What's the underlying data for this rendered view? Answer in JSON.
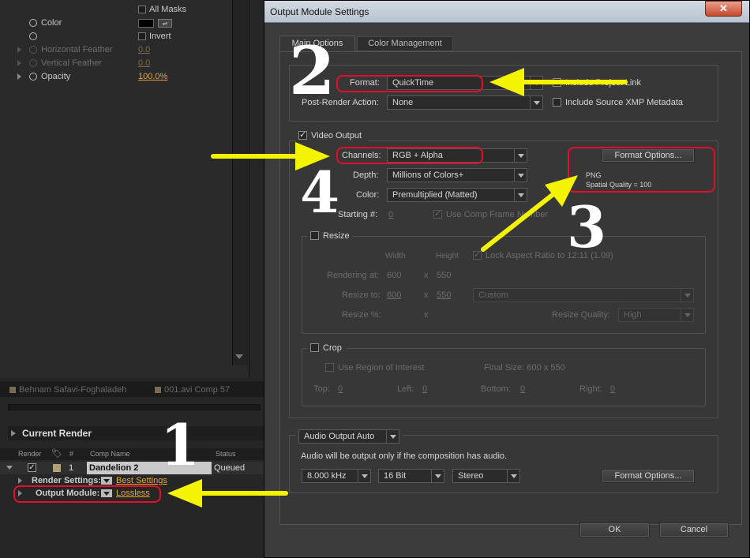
{
  "timeline": {
    "rows": [
      {
        "label": "All Masks",
        "checkbox": true
      },
      {
        "label": "Color",
        "stopwatch": true
      },
      {
        "label": "Invert",
        "checkbox": true,
        "stopwatch": true
      },
      {
        "label": "Horizontal Feather",
        "value": "0.0",
        "disabled": true
      },
      {
        "label": "Vertical Feather",
        "value": "0.0",
        "disabled": true
      },
      {
        "label": "Opacity",
        "value": "100.0%"
      }
    ]
  },
  "bottom_tabs": [
    "Behnam Safavi-Foghaladeh",
    "001.avi Comp 57"
  ],
  "render_queue": {
    "current_render_label": "Current Render",
    "headers": {
      "render": "Render",
      "num": "#",
      "comp_name": "Comp Name",
      "status": "Status"
    },
    "item": {
      "num": "1",
      "comp_name": "Dandelion 2",
      "status": "Queued"
    },
    "render_settings_label": "Render Settings:",
    "render_settings_value": "Best Settings",
    "output_module_label": "Output Module:",
    "output_module_value": "Lossless"
  },
  "dialog": {
    "title": "Output Module Settings",
    "close": "✕",
    "tabs": [
      "Main Options",
      "Color Management"
    ],
    "format_label": "Format:",
    "format_value": "QuickTime",
    "include_project_link": "Include Project Link",
    "post_render_label": "Post-Render Action:",
    "post_render_value": "None",
    "include_xmp": "Include Source XMP Metadata",
    "video_output": "Video Output",
    "channels_label": "Channels:",
    "channels_value": "RGB + Alpha",
    "depth_label": "Depth:",
    "depth_value": "Millions of Colors+",
    "color_label": "Color:",
    "color_value": "Premultiplied (Matted)",
    "starting_label": "Starting #:",
    "starting_value": "0",
    "use_comp_frame": "Use Comp Frame Number",
    "format_options": "Format Options...",
    "format_info_1": "PNG",
    "format_info_2": "Spatial Quality = 100",
    "resize": {
      "label": "Resize",
      "width": "Width",
      "height": "Height",
      "lock": "Lock Aspect Ratio to 12:11 (1.09)",
      "rendering_at": "Rendering at:",
      "w": "600",
      "x": "x",
      "h": "550",
      "resize_to": "Resize to:",
      "to_w": "600",
      "to_h": "550",
      "preset": "Custom",
      "resize_pct": "Resize %:",
      "quality_label": "Resize Quality:",
      "quality_value": "High"
    },
    "crop": {
      "label": "Crop",
      "use_roi": "Use Region of Interest",
      "final_size": "Final Size: 600 x 550",
      "top": "Top:",
      "left": "Left:",
      "bottom": "Bottom:",
      "right": "Right:",
      "zero": "0"
    },
    "audio": {
      "mode": "Audio Output Auto",
      "note": "Audio will be output only if the composition has audio.",
      "rate": "8.000 kHz",
      "bits": "16 Bit",
      "channels": "Stereo",
      "format_options": "Format Options..."
    },
    "ok": "OK",
    "cancel": "Cancel"
  },
  "annotations": {
    "n1": "1",
    "n2": "2",
    "n3": "3",
    "n4": "4",
    "arrow_color": "#f4f400",
    "highlight_color": "#e0102a"
  }
}
